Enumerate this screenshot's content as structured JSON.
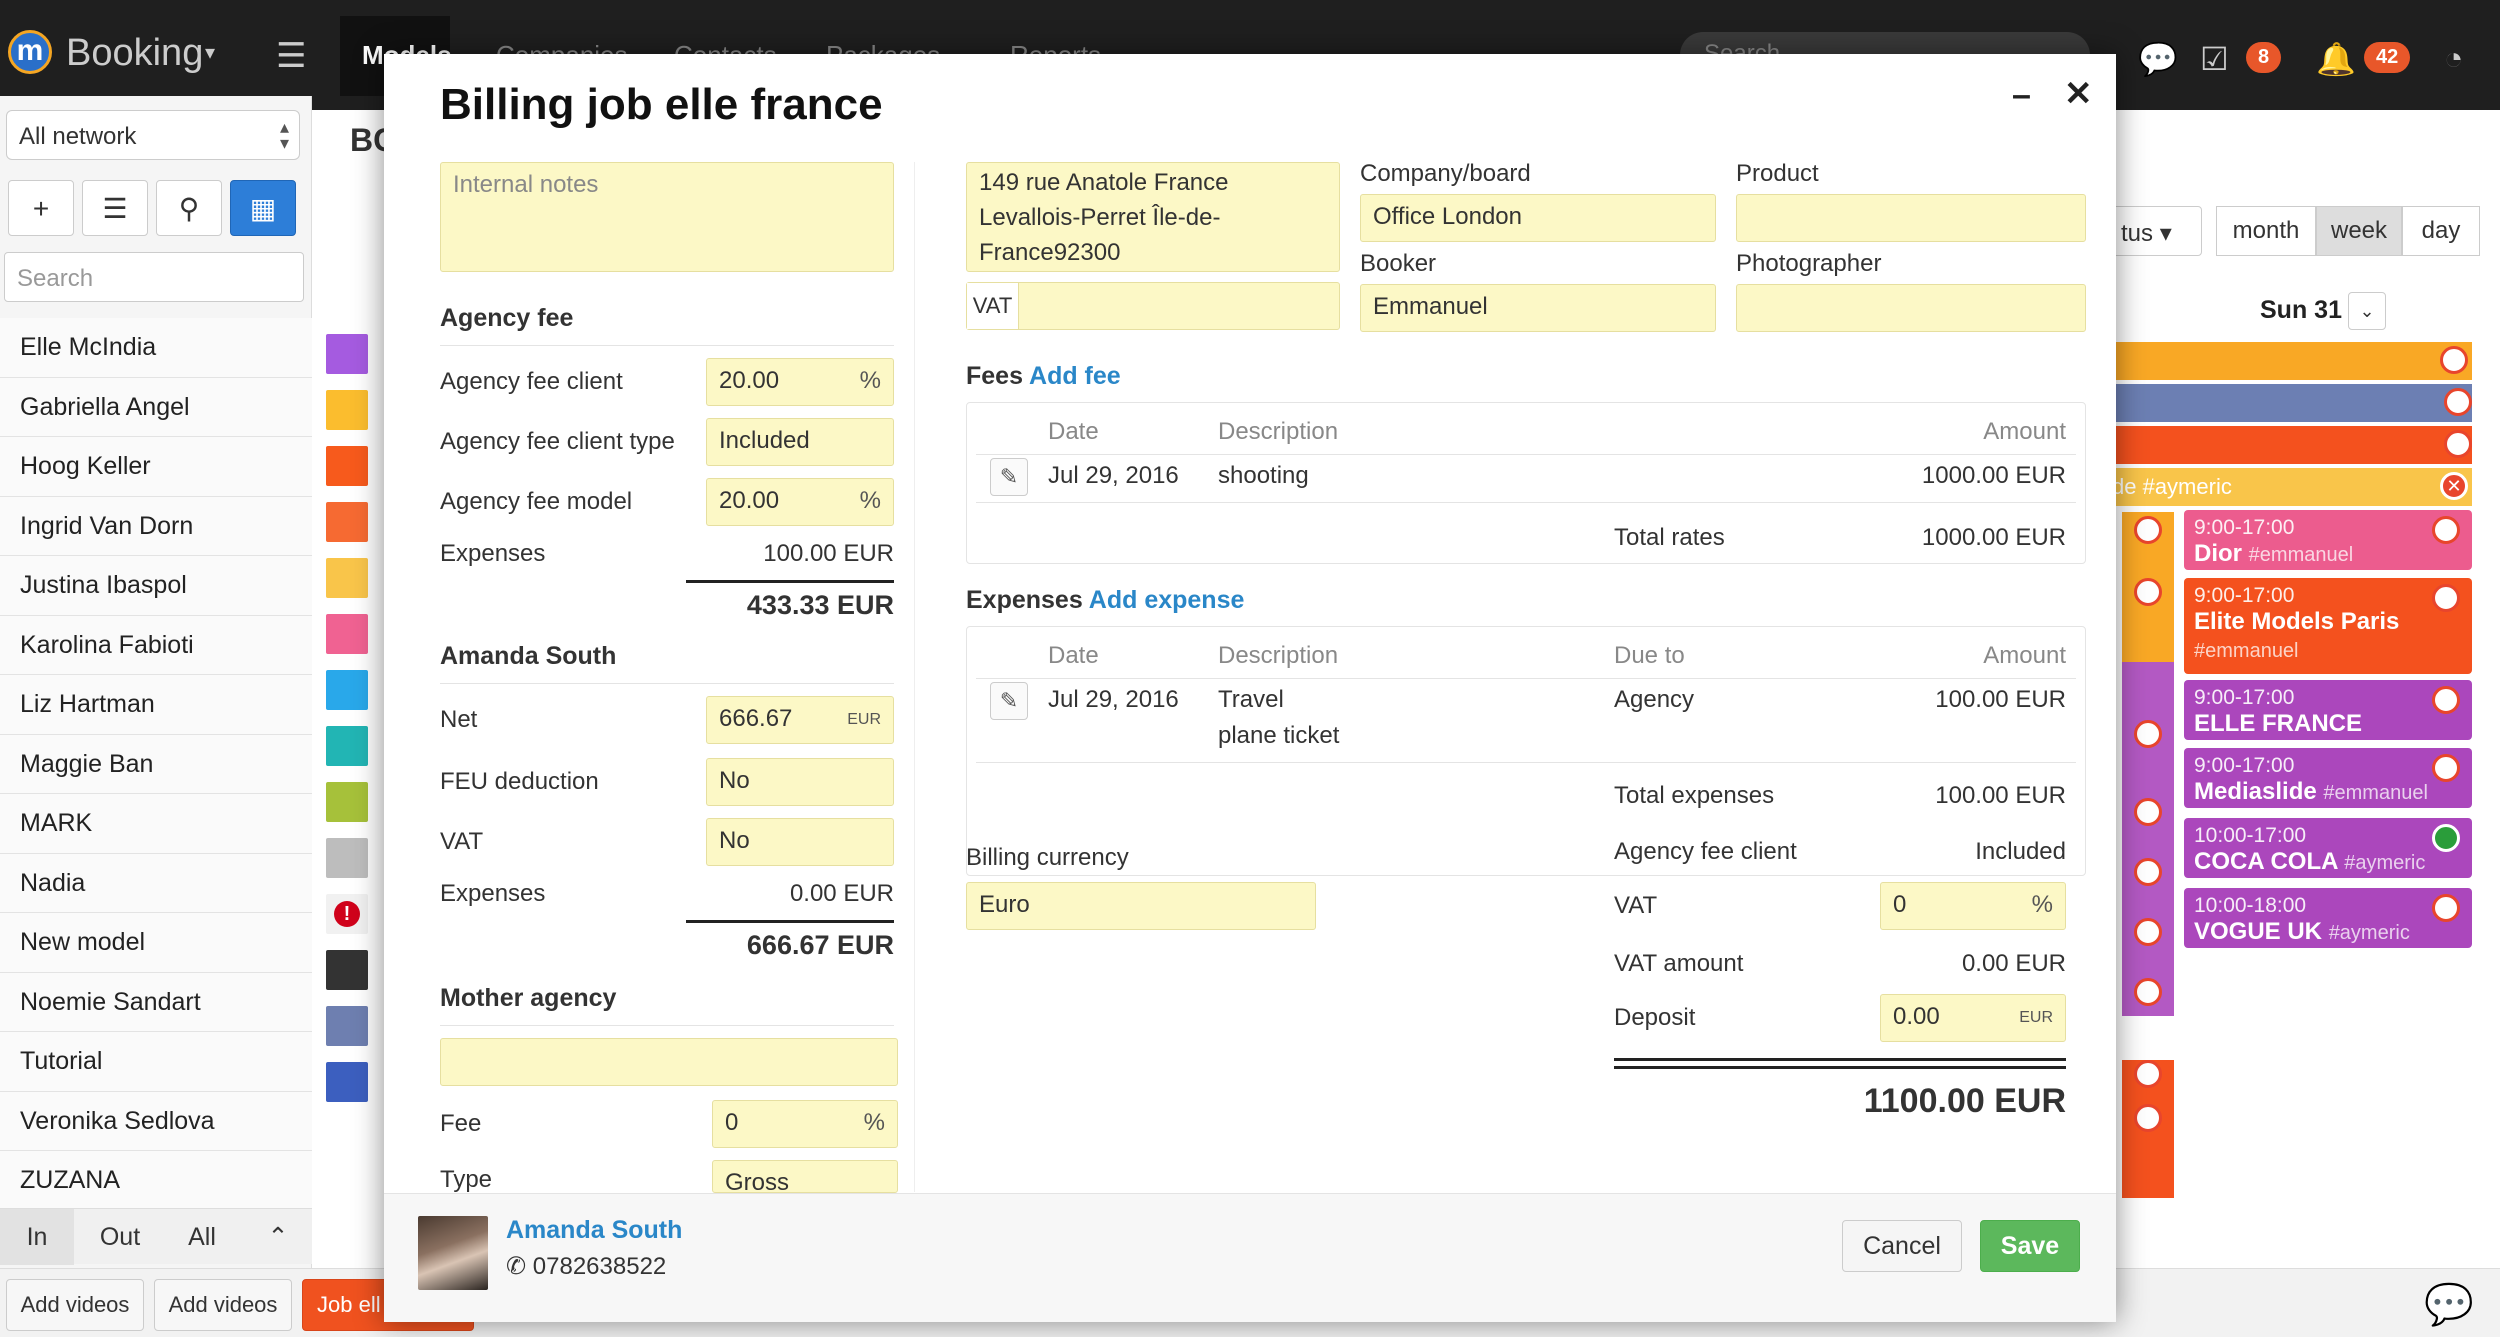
{
  "topbar": {
    "logo": "m",
    "brand": "Booking",
    "nav_active": "Models",
    "nav_items": [
      "Companies",
      "Contacts",
      "Packages",
      "Reports"
    ],
    "search_placeholder": "Search",
    "tasks_count": "8",
    "notifications_count": "42"
  },
  "sidebar": {
    "network": "All network",
    "search_placeholder": "Search",
    "models": [
      "Elle McIndia",
      "Gabriella Angel",
      "Hoog Keller",
      "Ingrid Van Dorn",
      "Justina Ibaspol",
      "Karolina Fabioti",
      "Liz Hartman",
      "Maggie Ban",
      "MARK",
      "Nadia",
      "New model",
      "Noemie Sandart",
      "Tutorial",
      "Veronika Sedlova",
      "ZUZANA"
    ],
    "tabs": [
      "In",
      "Out",
      "All"
    ],
    "swatch_colors": [
      "#a55be0",
      "#fbbd2e",
      "#f75a1c",
      "#f66a32",
      "#f9c54a",
      "#f06292",
      "#29a8ea",
      "#22b5b4",
      "#a6c13a",
      "#bdbdbd",
      "alert",
      "#333333",
      "#6e7fb0",
      "#3c5fbf"
    ]
  },
  "background": {
    "page_title": "BC",
    "status_label": "tus",
    "views": [
      "month",
      "week",
      "day"
    ],
    "active_view": "week",
    "day_label": "Sun 31",
    "bar_colors": [
      "#f9a825",
      "#6c7fb3",
      "#f4511e"
    ],
    "partial_event": "de #aymeric",
    "events": [
      {
        "time": "9:00-17:00",
        "title": "Dior",
        "tag": "#emmanuel",
        "color": "#ec5c8e"
      },
      {
        "time": "9:00-17:00",
        "title": "Elite Models Paris",
        "tag": "#emmanuel",
        "color": "#f4511e"
      },
      {
        "time": "9:00-17:00",
        "title": "ELLE FRANCE",
        "tag": "#emmanuel",
        "color": "#ab47bc"
      },
      {
        "time": "9:00-17:00",
        "title": "Mediaslide",
        "tag": "#emmanuel",
        "color": "#ab47bc"
      },
      {
        "time": "10:00-17:00",
        "title": "COCA COLA",
        "tag": "#aymeric",
        "color": "#ab47bc"
      },
      {
        "time": "10:00-18:00",
        "title": "VOGUE UK",
        "tag": "#aymeric",
        "color": "#ab47bc"
      }
    ],
    "partial_tags": [
      "nuel",
      "c",
      "anuel"
    ]
  },
  "bottombar": {
    "buttons": [
      "Add videos",
      "Add videos",
      "Job ell"
    ]
  },
  "modal": {
    "title": "Billing job elle france",
    "internal_notes_placeholder": "Internal notes",
    "agency_fee": {
      "header": "Agency fee",
      "client_label": "Agency fee client",
      "client_value": "20.00",
      "client_unit": "%",
      "client_type_label": "Agency fee client type",
      "client_type_value": "Included",
      "model_label": "Agency fee model",
      "model_value": "20.00",
      "model_unit": "%",
      "expenses_label": "Expenses",
      "expenses_value": "100.00 EUR",
      "total": "433.33 EUR"
    },
    "model_section": {
      "header": "Amanda South",
      "net_label": "Net",
      "net_value": "666.67",
      "net_unit": "EUR",
      "feu_label": "FEU deduction",
      "feu_value": "No",
      "vat_label": "VAT",
      "vat_value": "No",
      "expenses_label": "Expenses",
      "expenses_value": "0.00 EUR",
      "total": "666.67 EUR"
    },
    "mother_agency": {
      "header": "Mother agency",
      "value": "",
      "fee_label": "Fee",
      "fee_value": "0",
      "fee_unit": "%",
      "type_label": "Type",
      "type_value": "Gross"
    },
    "address": {
      "line1": "149 rue Anatole France",
      "line2": "Levallois-Perret Île-de-",
      "line3": "France92300",
      "vat_label": "VAT",
      "vat_value": ""
    },
    "company_label": "Company/board",
    "company_value": "Office London",
    "product_label": "Product",
    "product_value": "",
    "booker_label": "Booker",
    "booker_value": "Emmanuel",
    "photographer_label": "Photographer",
    "photographer_value": "",
    "fees": {
      "header": "Fees",
      "add_link": "Add fee",
      "col_date": "Date",
      "col_description": "Description",
      "col_amount": "Amount",
      "rows": [
        {
          "date": "Jul 29, 2016",
          "description": "shooting",
          "amount": "1000.00 EUR"
        }
      ],
      "total_label": "Total rates",
      "total_value": "1000.00 EUR"
    },
    "expenses": {
      "header": "Expenses",
      "add_link": "Add expense",
      "col_date": "Date",
      "col_description": "Description",
      "col_due": "Due to",
      "col_amount": "Amount",
      "rows": [
        {
          "date": "Jul 29, 2016",
          "description_line1": "Travel",
          "description_line2": "plane ticket",
          "due_to": "Agency",
          "amount": "100.00 EUR"
        }
      ],
      "total_label": "Total expenses",
      "total_value": "100.00 EUR"
    },
    "billing_currency_label": "Billing currency",
    "billing_currency_value": "Euro",
    "summary": {
      "fee_client_label": "Agency fee client",
      "fee_client_value": "Included",
      "vat_label": "VAT",
      "vat_value": "0",
      "vat_unit": "%",
      "vat_amount_label": "VAT amount",
      "vat_amount_value": "0.00 EUR",
      "deposit_label": "Deposit",
      "deposit_value": "0.00",
      "deposit_unit": "EUR",
      "grand_total": "1100.00 EUR"
    },
    "footer": {
      "model_name": "Amanda South",
      "phone": "0782638522",
      "cancel": "Cancel",
      "save": "Save"
    }
  }
}
